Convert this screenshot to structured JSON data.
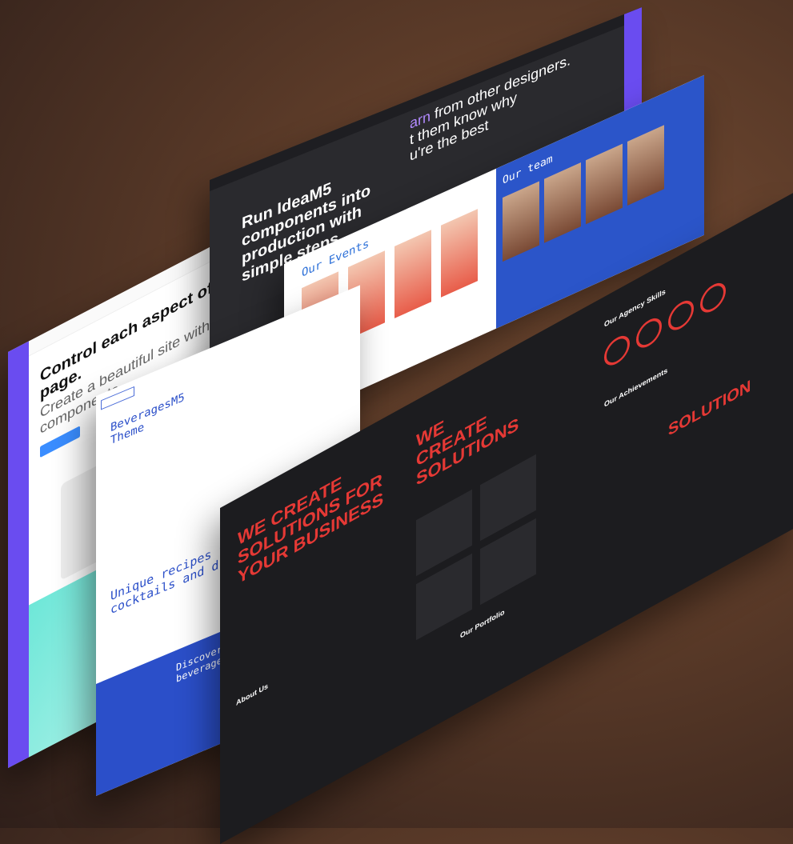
{
  "layer1": {
    "headline": "Control each aspect of a page.",
    "subline": "Create a beautiful site with crafted components."
  },
  "layer2": {
    "hero": "Run IdeaM5 components into production with simple steps.",
    "right_highlight": "arn",
    "right_text": "from other designers.",
    "right_line2": "t them know why",
    "right_line3": "u're the best"
  },
  "layer3": {
    "title": "BeveragesM5 Theme",
    "recipes": "Unique recipes for cocktails and drin",
    "discover": "Discover a beverages"
  },
  "layer4": {
    "events_title": "Our Events",
    "team_title": "Our team"
  },
  "layer5": {
    "hero1": "WE CREATE SOLUTIONS FOR YOUR BUSINESS",
    "hero2": "WE CREATE SOLUTIONS",
    "hero3": "SOLUTION",
    "skills_title": "Our Agency Skills",
    "achievements_title": "Our Achievements",
    "portfolio_title": "Our Portfolio",
    "about_title": "About Us"
  },
  "colors": {
    "accent_red": "#e53935",
    "purple": "#6a4cf0",
    "blue": "#2b4fc9",
    "background": "#5a3a28"
  }
}
